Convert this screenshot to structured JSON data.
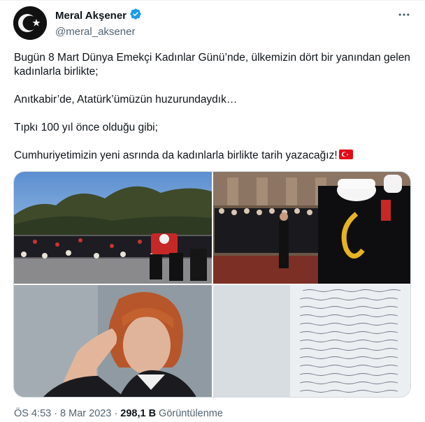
{
  "author": {
    "name": "Meral Akşener",
    "handle": "@meral_aksener"
  },
  "tweet": {
    "lines": [
      "Bugün 8 Mart Dünya Emekçi Kadınlar Günü’nde, ülkemizin dört bir yanından gelen kadınlarla birlikte;",
      "Anıtkabir’de, Atatürk’ümüzün huzurundaydık…",
      "Tıpkı 100 yıl önce olduğu gibi;",
      "Cumhuriyetimizin yeni asrında da kadınlarla birlikte tarih yazacağız!"
    ]
  },
  "meta": {
    "time": "ÖS 4:53",
    "separator1": "·",
    "date": "8 Mar 2023",
    "separator2": "·",
    "views": "298,1 B",
    "views_label": "Görüntülenme"
  },
  "icons": {
    "verified": "verified-badge-icon",
    "more": "more-options-icon",
    "flag": "turkey-flag-icon"
  },
  "colors": {
    "verified": "#1d9bf0",
    "text_secondary": "#536471",
    "flag_red": "#e30a17"
  }
}
